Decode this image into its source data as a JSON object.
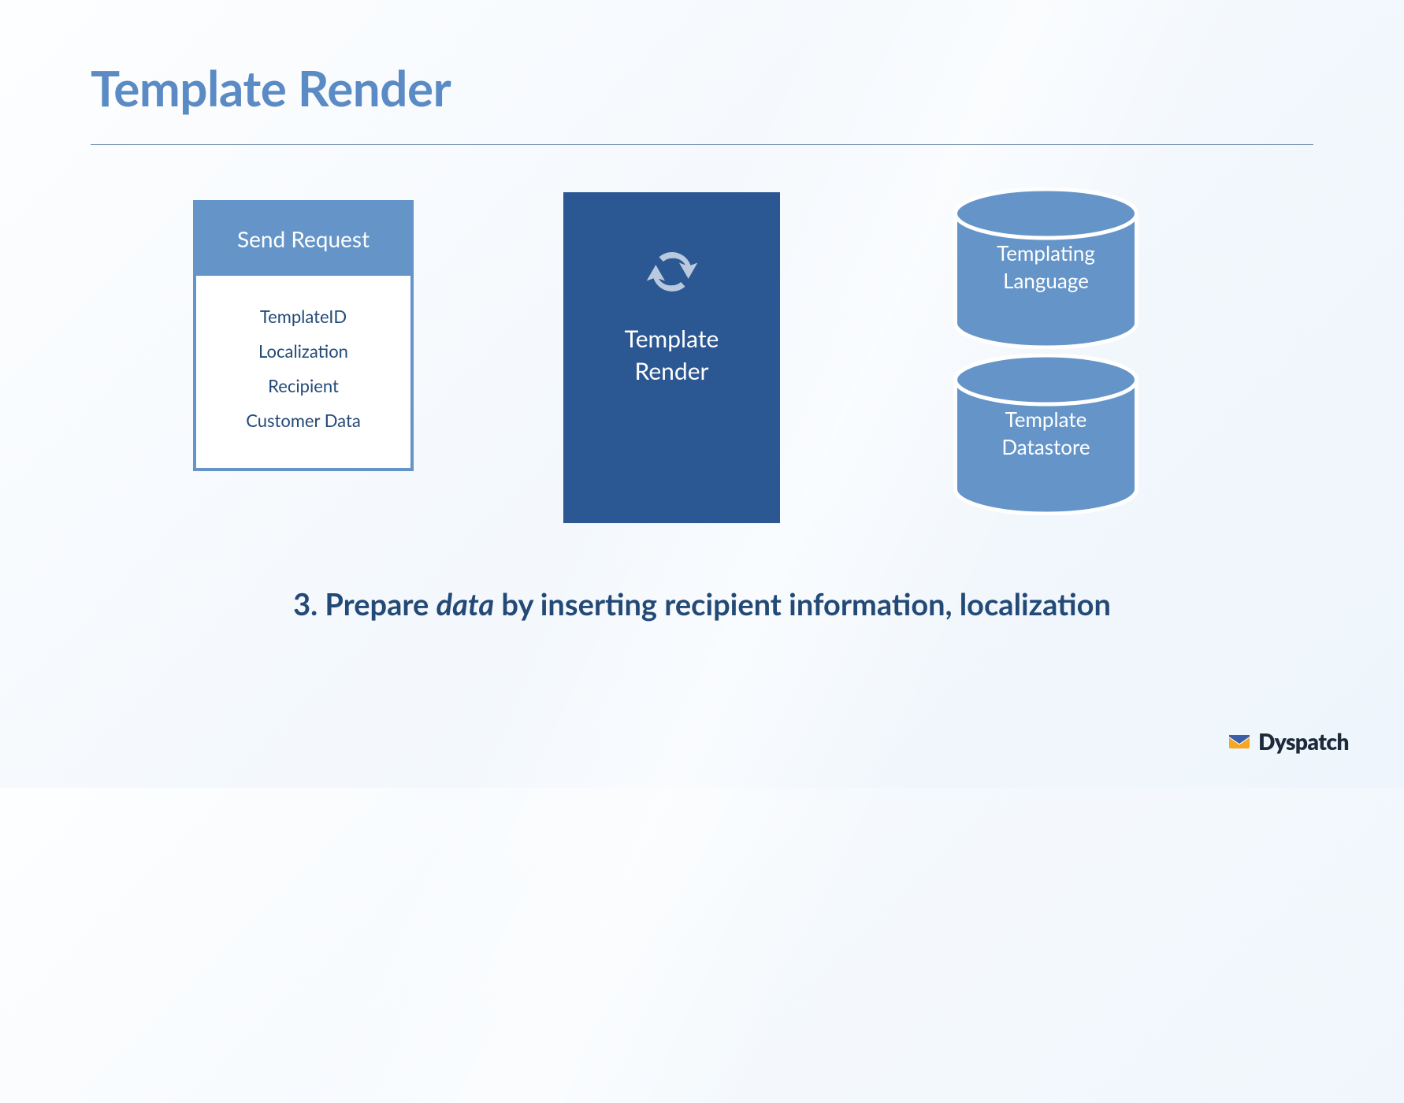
{
  "title": "Template Render",
  "send_request": {
    "header": "Send Request",
    "items": [
      "TemplateID",
      "Localization",
      "Recipient",
      "Customer Data"
    ]
  },
  "render_card": {
    "label_line1": "Template",
    "label_line2": "Render"
  },
  "cylinders": {
    "top_line1": "Templating",
    "top_line2": "Language",
    "bottom_line1": "Template",
    "bottom_line2": "Datastore"
  },
  "caption": {
    "prefix": "3. Prepare ",
    "em": "data",
    "suffix": " by inserting recipient information, localization"
  },
  "brand": "Dyspatch",
  "colors": {
    "title": "#5b8bc4",
    "deep_blue": "#2b5793",
    "mid_blue": "#6494c8",
    "text_navy": "#234a77"
  }
}
